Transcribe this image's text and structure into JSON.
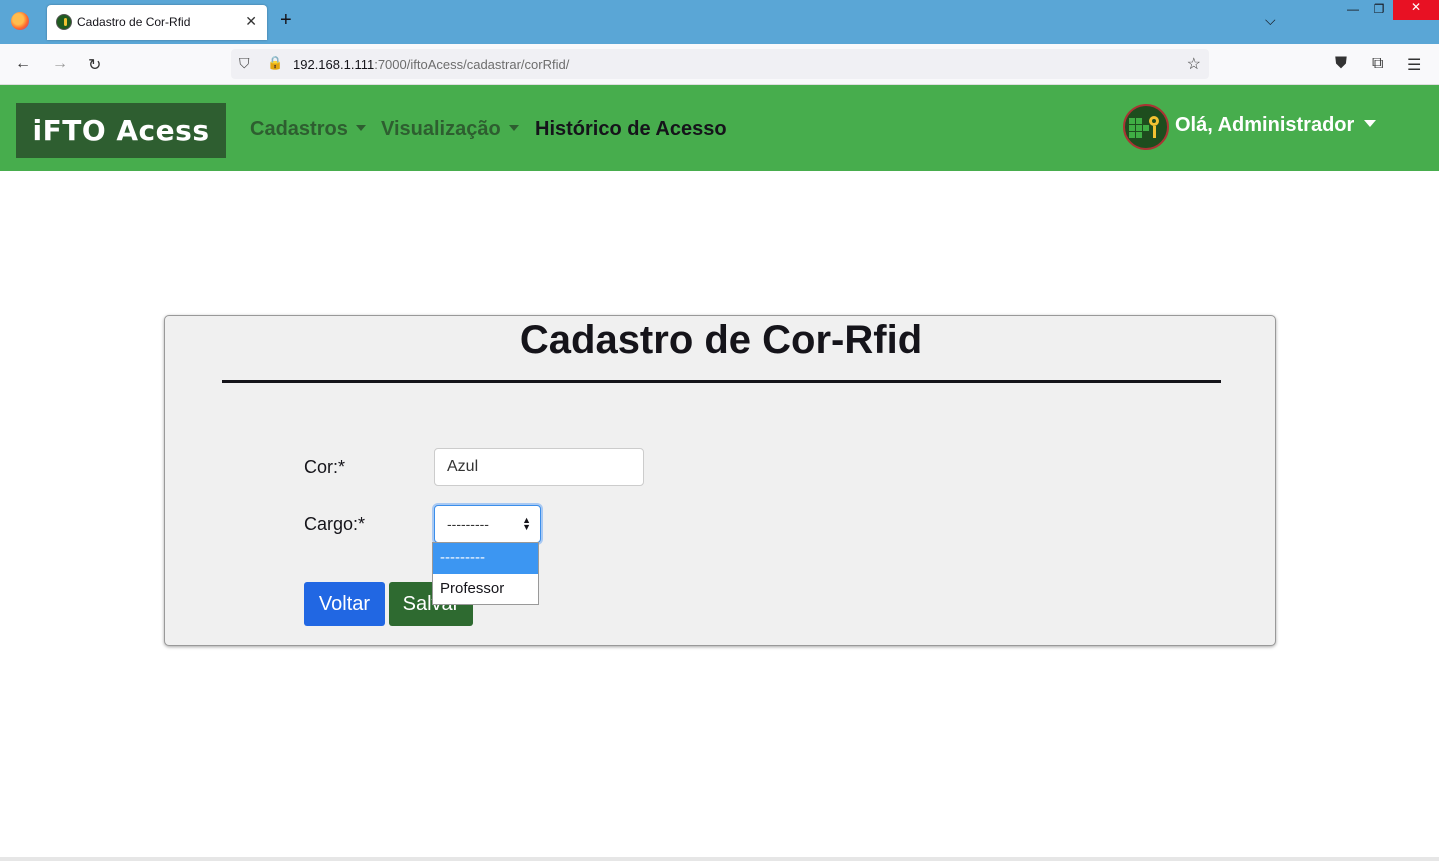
{
  "browser": {
    "tab_title": "Cadastro de Cor-Rfid",
    "url_host": "192.168.1.111",
    "url_rest": ":7000/iftoAcess/cadastrar/corRfid/",
    "icons": [
      "firefox-icon",
      "back-icon",
      "forward-icon",
      "reload-icon",
      "shield-icon",
      "lock-icon",
      "star-icon",
      "pocket-icon",
      "extensions-icon",
      "menu-icon"
    ]
  },
  "site": {
    "brand": "iFTO Acess",
    "menu": {
      "cadastros": "Cadastros",
      "visualizacao": "Visualização",
      "historico": "Histórico de Acesso"
    },
    "user_greeting": "Olá, Administrador"
  },
  "form": {
    "title": "Cadastro de Cor-Rfid",
    "cor_label": "Cor:*",
    "cor_value": "Azul",
    "cargo_label": "Cargo:*",
    "cargo_selected": "---------",
    "cargo_options": [
      "---------",
      "Professor"
    ],
    "back_label": "Voltar",
    "save_label": "Salvar"
  },
  "colors": {
    "nav_green": "#47ad4d",
    "brand_dark_green": "#2e5e30",
    "back_blue": "#2167e3",
    "option_highlight": "#3c96f2"
  }
}
